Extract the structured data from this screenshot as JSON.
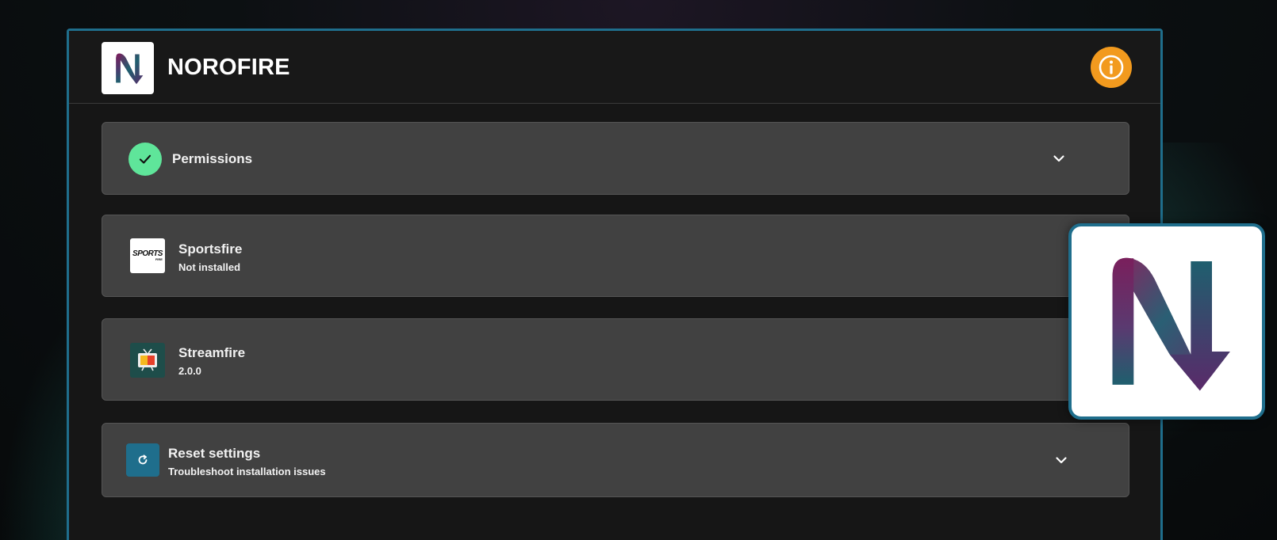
{
  "app": {
    "title": "NOROFIRE",
    "logo_icon": "norofire-n-logo",
    "info_icon": "info-icon"
  },
  "colors": {
    "accent": "#1f6e8c",
    "info": "#f29a1e",
    "success": "#5fe59a",
    "card": "#414141",
    "logo_purple": "#7a1f5c",
    "logo_teal": "#1f5f6e"
  },
  "cards": {
    "permissions": {
      "title": "Permissions",
      "icon": "check-icon"
    },
    "sportsfire": {
      "title": "Sportsfire",
      "status": "Not installed",
      "icon": "sportsfire-icon",
      "icon_text": "SPORTS",
      "icon_subtext": "FIRE"
    },
    "streamfire": {
      "title": "Streamfire",
      "version": "2.0.0",
      "icon": "tv-icon"
    },
    "reset": {
      "title": "Reset settings",
      "subtitle": "Troubleshoot installation issues",
      "icon": "refresh-icon"
    }
  }
}
